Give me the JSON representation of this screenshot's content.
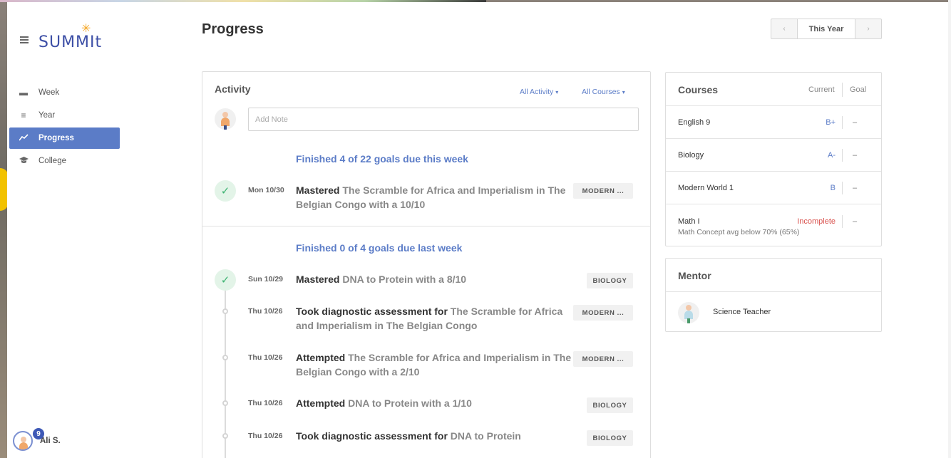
{
  "brand": {
    "logo_text": "SUMMIt"
  },
  "colors": {
    "accent": "#5b7cc7",
    "brand": "#3d4fa6",
    "success": "#3cb371",
    "danger": "#d9534f",
    "logo_star": "#f5a623"
  },
  "sidebar": {
    "items": [
      {
        "label": "Week",
        "icon": "calendar-week-icon",
        "active": false
      },
      {
        "label": "Year",
        "icon": "list-lines-icon",
        "active": false
      },
      {
        "label": "Progress",
        "icon": "trend-line-icon",
        "active": true
      },
      {
        "label": "College",
        "icon": "graduation-cap-icon",
        "active": false
      }
    ],
    "user": {
      "name": "Ali S.",
      "notification_count": "9"
    }
  },
  "header": {
    "title": "Progress",
    "period": {
      "label": "This Year",
      "prev": "‹",
      "next": "›"
    }
  },
  "activity": {
    "title": "Activity",
    "filters": {
      "activity": "All Activity",
      "courses": "All Courses",
      "caret": "▾"
    },
    "note_placeholder": "Add Note",
    "sections": [
      {
        "heading": "Finished 4 of 22 goals due this week",
        "entries": [
          {
            "date": "Mon 10/30",
            "verb": "Mastered",
            "text": " The Scramble for Africa and Imperialism in The Belgian Congo with a 10/10",
            "tag": "MODERN ...",
            "status": "done"
          }
        ]
      },
      {
        "heading": "Finished 0 of 4 goals due last week",
        "entries": [
          {
            "date": "Sun 10/29",
            "verb": "Mastered",
            "text": " DNA to Protein with a 8/10",
            "tag": "BIOLOGY",
            "status": "done"
          },
          {
            "date": "Thu 10/26",
            "verb": "Took diagnostic assessment for",
            "text": " The Scramble for Africa and Imperialism in The Belgian Congo",
            "tag": "MODERN ...",
            "status": "pending"
          },
          {
            "date": "Thu 10/26",
            "verb": "Attempted",
            "text": " The Scramble for Africa and Imperialism in The Belgian Congo with a 2/10",
            "tag": "MODERN ...",
            "status": "pending"
          },
          {
            "date": "Thu 10/26",
            "verb": "Attempted",
            "text": " DNA to Protein with a 1/10",
            "tag": "BIOLOGY",
            "status": "pending"
          },
          {
            "date": "Thu 10/26",
            "verb": "Took diagnostic assessment for",
            "text": " DNA to Protein",
            "tag": "BIOLOGY",
            "status": "pending"
          }
        ]
      }
    ]
  },
  "courses": {
    "title": "Courses",
    "col_current": "Current",
    "col_goal": "Goal",
    "rows": [
      {
        "name": "English 9",
        "grade": "B+",
        "goal": "–",
        "note": ""
      },
      {
        "name": "Biology",
        "grade": "A-",
        "goal": "–",
        "note": ""
      },
      {
        "name": "Modern World 1",
        "grade": "B",
        "goal": "–",
        "note": ""
      },
      {
        "name": "Math I",
        "grade": "Incomplete",
        "goal": "–",
        "note": "Math Concept avg below 70% (65%)"
      }
    ]
  },
  "mentor": {
    "title": "Mentor",
    "name": "Science Teacher"
  }
}
